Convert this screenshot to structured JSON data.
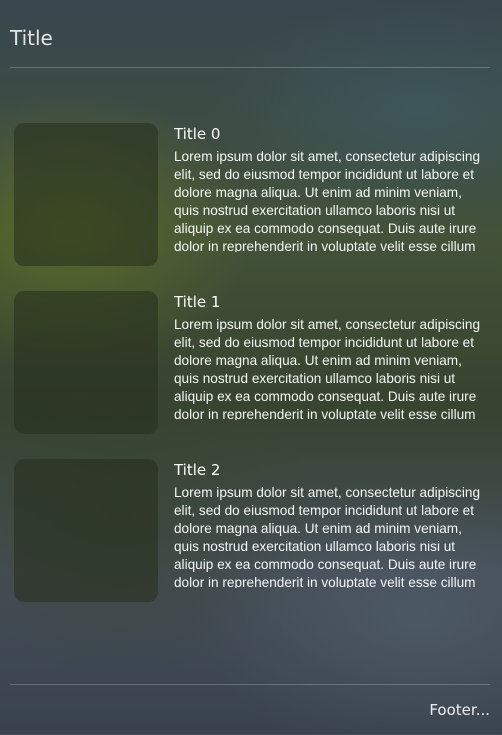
{
  "header": {
    "title": "Title"
  },
  "cards": [
    {
      "title": "Title 0",
      "body": "Lorem ipsum dolor sit amet, consectetur adipiscing elit, sed do eiusmod tempor incididunt ut labore et dolore magna aliqua. Ut enim ad minim veniam, quis nostrud exercitation ullamco laboris nisi ut aliquip ex ea commodo consequat. Duis aute irure dolor in reprehenderit in voluptate velit esse cillum dolore eu fugiat nulla pariatur."
    },
    {
      "title": "Title 1",
      "body": "Lorem ipsum dolor sit amet, consectetur adipiscing elit, sed do eiusmod tempor incididunt ut labore et dolore magna aliqua. Ut enim ad minim veniam, quis nostrud exercitation ullamco laboris nisi ut aliquip ex ea commodo consequat. Duis aute irure dolor in reprehenderit in voluptate velit esse cillum dolore eu fugiat nulla pariatur."
    },
    {
      "title": "Title 2",
      "body": "Lorem ipsum dolor sit amet, consectetur adipiscing elit, sed do eiusmod tempor incididunt ut labore et dolore magna aliqua. Ut enim ad minim veniam, quis nostrud exercitation ullamco laboris nisi ut aliquip ex ea commodo consequat. Duis aute irure dolor in reprehenderit in voluptate velit esse cillum dolore eu fugiat nulla pariatur."
    }
  ],
  "footer": {
    "text": "Footer..."
  }
}
